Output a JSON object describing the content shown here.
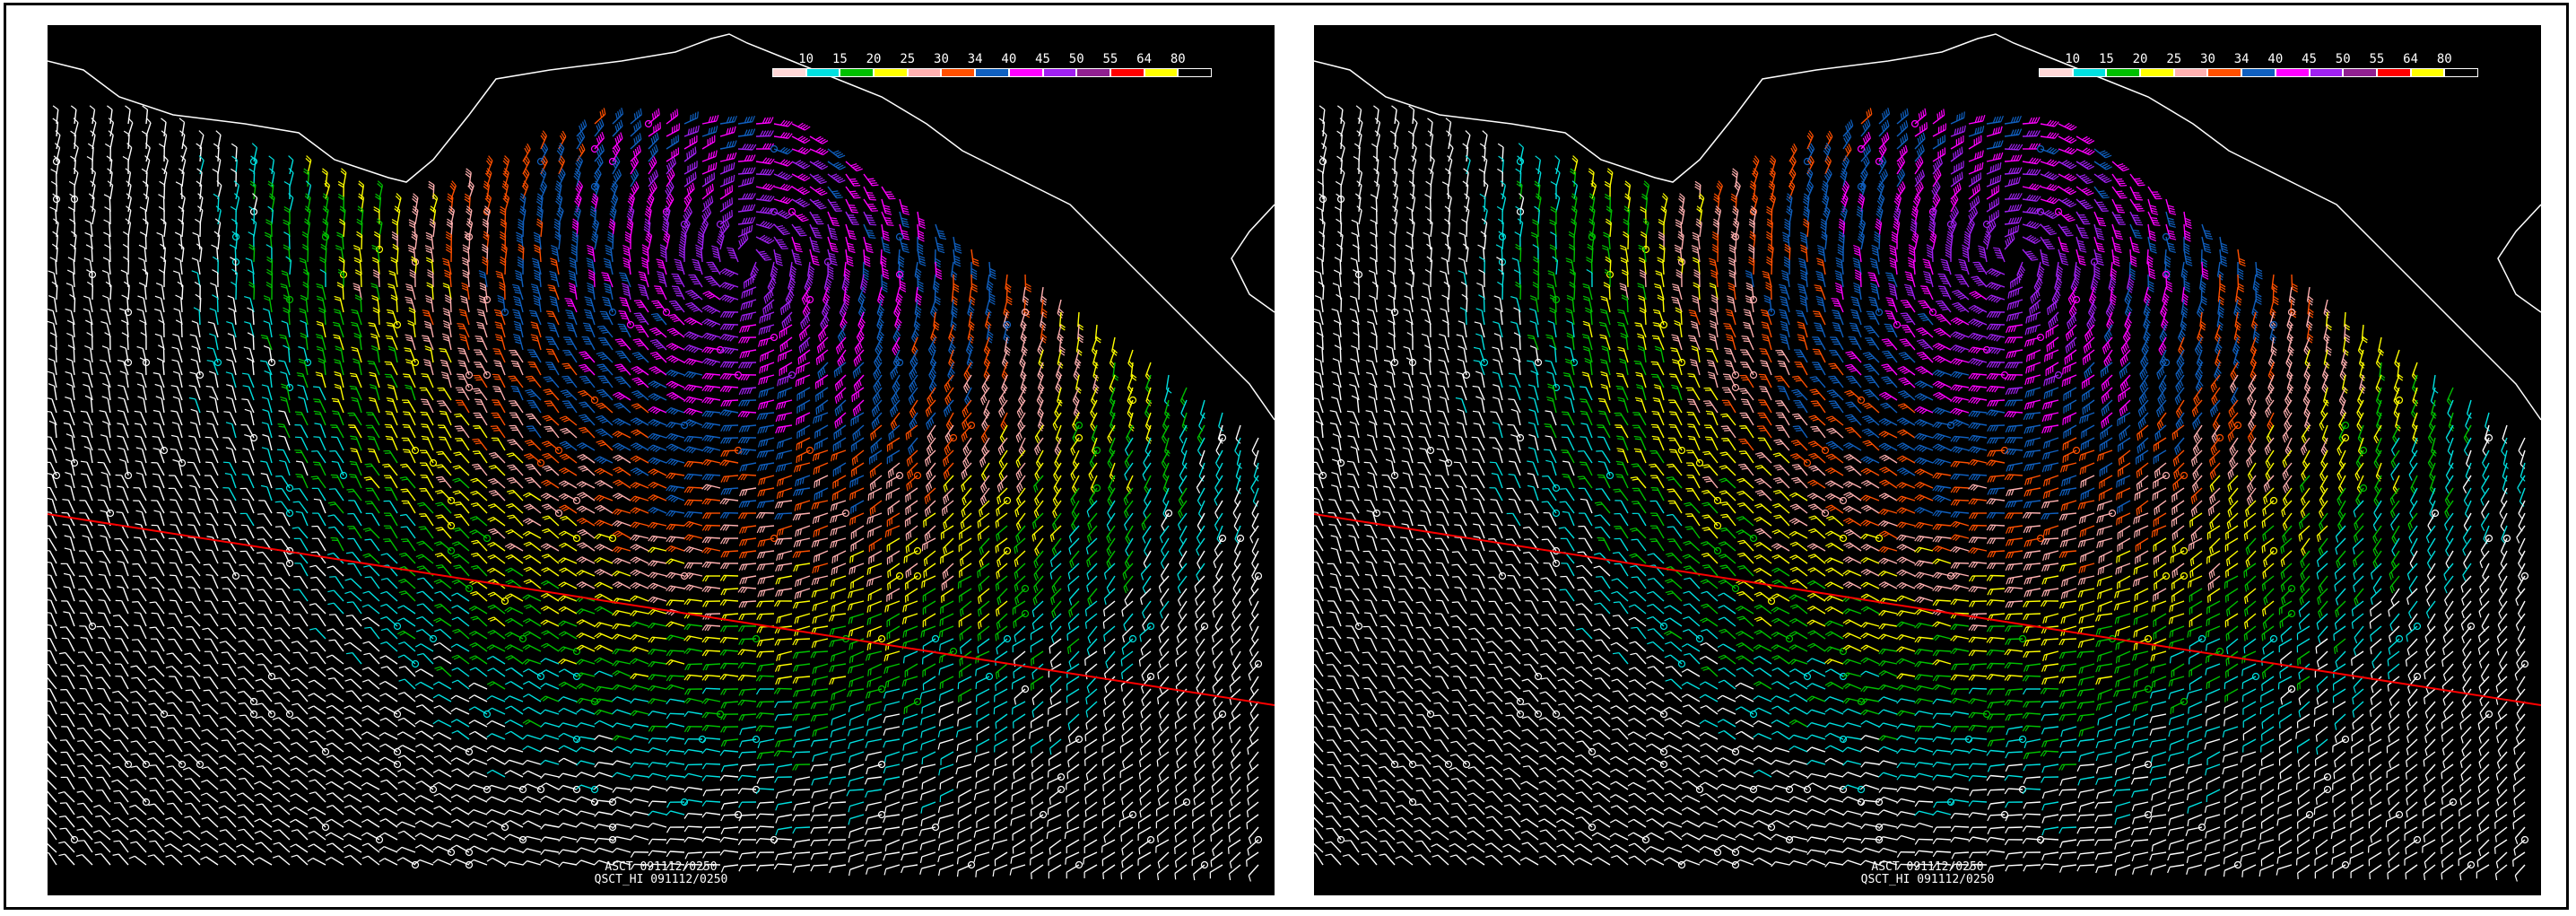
{
  "legend": {
    "labels": [
      "10",
      "15",
      "20",
      "25",
      "30",
      "34",
      "40",
      "45",
      "50",
      "55",
      "64",
      "80"
    ],
    "colors": [
      "#ffd7d7",
      "#00e0e0",
      "#00c000",
      "#ffff00",
      "#ffb0b0",
      "#ff5000",
      "#1060c0",
      "#ff00ff",
      "#a020f0",
      "#902090",
      "#ff0000",
      "#ffff00",
      "#000000"
    ]
  },
  "panels": [
    {
      "caption_line1": "ASCT 091112/0250",
      "caption_line2": "QSCT_HI 091112/0250"
    },
    {
      "caption_line1": "ASCT 091112/0250",
      "caption_line2": "QSCT_HI 091112/0250"
    }
  ],
  "colors": {
    "background": "#000000",
    "coastline": "#ffffff",
    "track_line": "#ff0000",
    "frame": "#000000"
  }
}
